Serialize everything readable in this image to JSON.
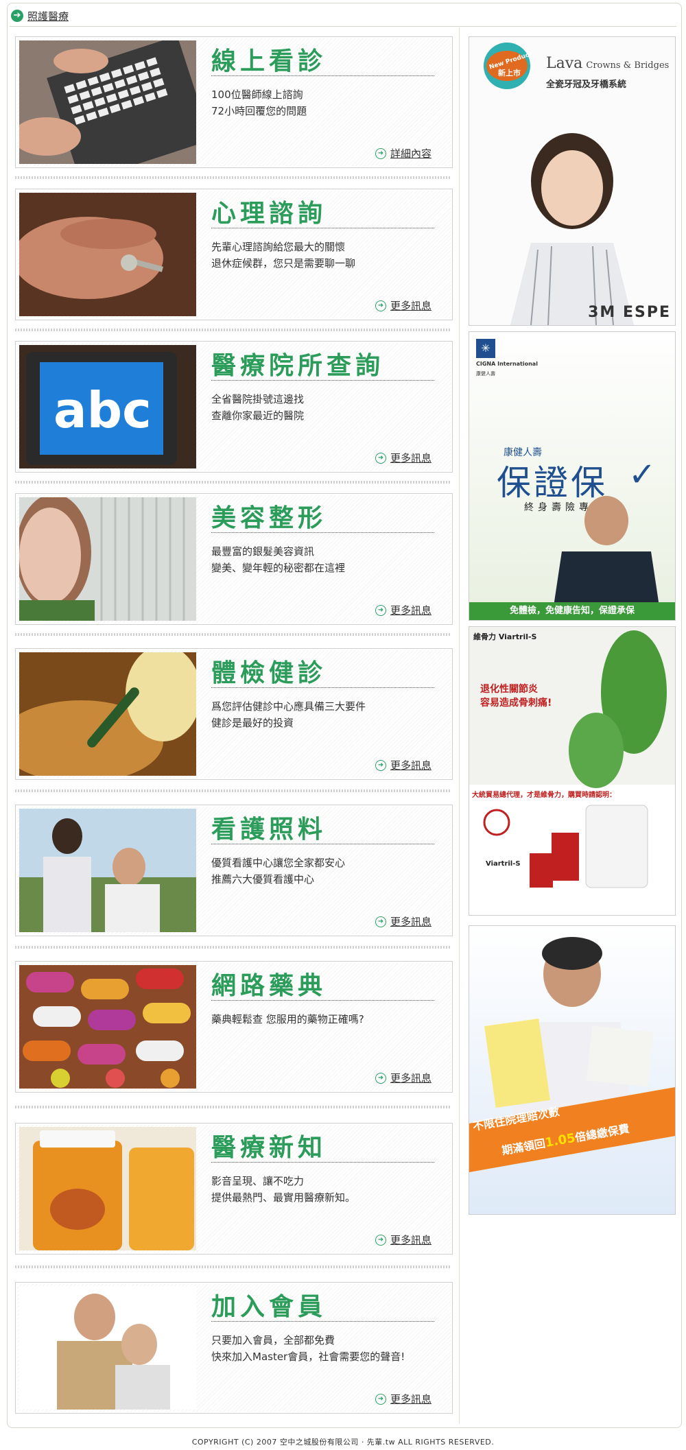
{
  "header": {
    "title": "照護醫療"
  },
  "cards": [
    {
      "title": "線上看診",
      "desc": "100位醫師線上諮詢\n72小時回覆您的問題",
      "link": "詳細內容"
    },
    {
      "title": "心理諮詢",
      "desc": "先輩心理諮詢給您最大的關懷\n退休症候群，您只是需要聊一聊",
      "link": "更多訊息"
    },
    {
      "title": "醫療院所查詢",
      "desc": "全省醫院掛號這邊找\n查離你家最近的醫院",
      "link": "更多訊息"
    },
    {
      "title": "美容整形",
      "desc": "最豐富的銀髮美容資訊\n變美、變年輕的秘密都在這裡",
      "link": "更多訊息"
    },
    {
      "title": "體檢健診",
      "desc": "爲您評估健診中心應具備三大要件\n健診是最好的投資",
      "link": "更多訊息"
    },
    {
      "title": "看護照料",
      "desc": "優質看護中心讓您全家都安心\n推薦六大優質看護中心",
      "link": "更多訊息"
    },
    {
      "title": "網路藥典",
      "desc": "藥典輕鬆查 您服用的藥物正確嗎?",
      "link": "更多訊息"
    },
    {
      "title": "醫療新知",
      "desc": "影音呈現、讓不吃力\n提供最熱門、最實用醫療新知。",
      "link": "更多訊息"
    },
    {
      "title": "加入會員",
      "desc": "只要加入會員，全部都免費\n快來加入Master會員，社會需要您的聲音!",
      "link": "更多訊息"
    }
  ],
  "ads": {
    "lava": {
      "badge1": "New Product",
      "badge2": "新上市",
      "brand": "Lava",
      "brand_sub": "Crowns & Bridges",
      "tagline": "全瓷牙冠及牙橋系統",
      "maker": "3M ESPE"
    },
    "cigna": {
      "company": "CIGNA International",
      "company_cn": "康健人壽",
      "title_small": "康健人壽",
      "title_big": "保證保",
      "subtitle": "終身壽險專案",
      "footer": "免體檢，免健康告知，保證承保"
    },
    "viartril": {
      "brand": "維骨力 Viartril-S",
      "headline1": "退化性關節炎",
      "headline2": "容易造成骨刺痛!",
      "notice": "大統貿易總代理，才是維骨力，購買時請認明：",
      "product": "Viartril-S"
    },
    "insurance": {
      "line1": "不限住院理賠次數",
      "line2a": "期滿領回",
      "line2b": "1.05",
      "line2c": "倍總繳保費"
    }
  },
  "footer": {
    "text": "COPYRIGHT (C) 2007 空中之城股份有限公司 · 先輩.tw  ALL RIGHTS RESERVED."
  },
  "colors": {
    "accent_green": "#2b9c5a",
    "border": "#cfcfcf"
  }
}
